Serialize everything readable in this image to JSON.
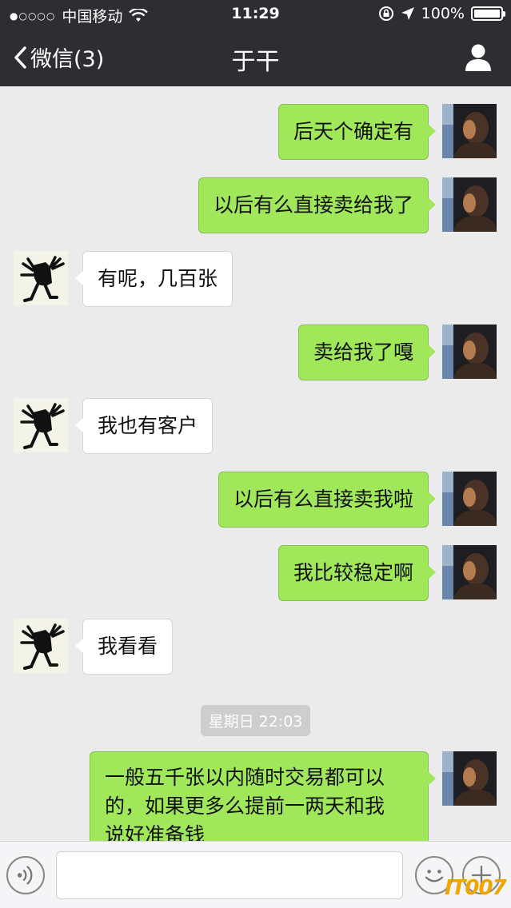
{
  "status_bar": {
    "signal": "●○○○○",
    "carrier": "中国移动",
    "time": "11:29",
    "battery": "100%",
    "battery_level": 1.0
  },
  "nav": {
    "back_label": "微信(3)",
    "title": "于干"
  },
  "messages": [
    {
      "from": "me",
      "text": "后天个确定有"
    },
    {
      "from": "me",
      "text": "以后有么直接卖给我了"
    },
    {
      "from": "other",
      "text": "有呢，几百张"
    },
    {
      "from": "me",
      "text": "卖给我了嘎"
    },
    {
      "from": "other",
      "text": "我也有客户"
    },
    {
      "from": "me",
      "text": "以后有么直接卖我啦"
    },
    {
      "from": "me",
      "text": "我比较稳定啊"
    },
    {
      "from": "other",
      "text": "我看看"
    },
    {
      "from": "me",
      "lines": [
        "一般五千张以内随时交易都可以",
        "的，如果更多么提前一两天和我",
        "说好准备钱"
      ]
    }
  ],
  "timestamp": "星期日 22:03",
  "input": {
    "value": "",
    "placeholder": ""
  },
  "icons": {
    "back": "chevron-left-icon",
    "profile": "person-icon",
    "wifi": "wifi-icon",
    "lock": "orientation-lock-icon",
    "location": "location-arrow-icon",
    "voice": "voice-icon",
    "emoji": "emoji-icon",
    "plus": "plus-icon"
  },
  "colors": {
    "topbar": "#2e2e32",
    "background": "#ebebeb",
    "my_bubble": "#a0e75a",
    "their_bubble": "#ffffff",
    "watermark": "#f2a500"
  },
  "watermark": "IT007"
}
